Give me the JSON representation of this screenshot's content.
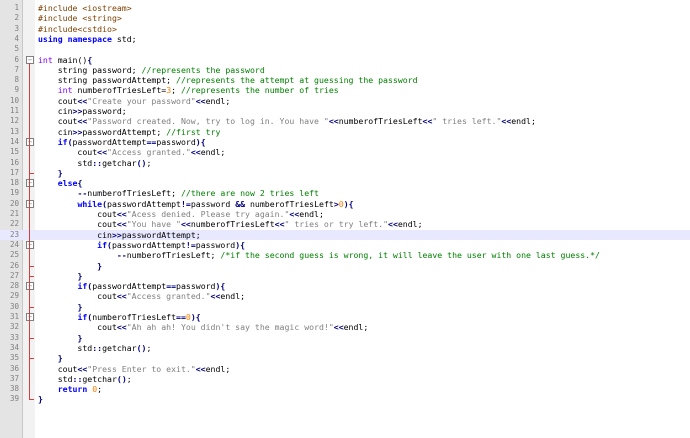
{
  "editor": {
    "lines": [
      {
        "n": "1",
        "fold": "",
        "current": false,
        "tokens": [
          {
            "t": "pp",
            "v": "#include <iostream>"
          }
        ]
      },
      {
        "n": "2",
        "fold": "",
        "current": false,
        "tokens": [
          {
            "t": "pp",
            "v": "#include <string>"
          }
        ]
      },
      {
        "n": "3",
        "fold": "",
        "current": false,
        "tokens": [
          {
            "t": "pp",
            "v": "#include<cstdio>"
          }
        ]
      },
      {
        "n": "4",
        "fold": "",
        "current": false,
        "tokens": [
          {
            "t": "kw",
            "v": "using namespace"
          },
          {
            "t": "plain",
            "v": " std;"
          }
        ]
      },
      {
        "n": "5",
        "fold": "",
        "current": false,
        "tokens": []
      },
      {
        "n": "6",
        "fold": "minus",
        "current": false,
        "tokens": [
          {
            "t": "type",
            "v": "int"
          },
          {
            "t": "plain",
            "v": " main()"
          },
          {
            "t": "op",
            "v": "{"
          }
        ]
      },
      {
        "n": "7",
        "fold": "",
        "current": false,
        "tokens": [
          {
            "t": "plain",
            "v": "    string password; "
          },
          {
            "t": "cmt",
            "v": "//represents the password"
          }
        ]
      },
      {
        "n": "8",
        "fold": "",
        "current": false,
        "tokens": [
          {
            "t": "plain",
            "v": "    string passwordAttempt; "
          },
          {
            "t": "cmt",
            "v": "//represents the attempt at guessing the password"
          }
        ]
      },
      {
        "n": "9",
        "fold": "",
        "current": false,
        "tokens": [
          {
            "t": "plain",
            "v": "    "
          },
          {
            "t": "type",
            "v": "int"
          },
          {
            "t": "plain",
            "v": " numberofTriesLeft="
          },
          {
            "t": "num",
            "v": "3"
          },
          {
            "t": "plain",
            "v": "; "
          },
          {
            "t": "cmt",
            "v": "//represents the number of tries"
          }
        ]
      },
      {
        "n": "10",
        "fold": "",
        "current": false,
        "tokens": [
          {
            "t": "plain",
            "v": "    cout"
          },
          {
            "t": "op",
            "v": "<<"
          },
          {
            "t": "str",
            "v": "\"Create your password\""
          },
          {
            "t": "op",
            "v": "<<"
          },
          {
            "t": "plain",
            "v": "endl;"
          }
        ]
      },
      {
        "n": "11",
        "fold": "",
        "current": false,
        "tokens": [
          {
            "t": "plain",
            "v": "    cin"
          },
          {
            "t": "op",
            "v": ">>"
          },
          {
            "t": "plain",
            "v": "password;"
          }
        ]
      },
      {
        "n": "12",
        "fold": "",
        "current": false,
        "tokens": [
          {
            "t": "plain",
            "v": "    cout"
          },
          {
            "t": "op",
            "v": "<<"
          },
          {
            "t": "str",
            "v": "\"Password created. Now, try to log in. You have \""
          },
          {
            "t": "op",
            "v": "<<"
          },
          {
            "t": "plain",
            "v": "numberofTriesLeft"
          },
          {
            "t": "op",
            "v": "<<"
          },
          {
            "t": "str",
            "v": "\" tries left.\""
          },
          {
            "t": "op",
            "v": "<<"
          },
          {
            "t": "plain",
            "v": "endl;"
          }
        ]
      },
      {
        "n": "13",
        "fold": "",
        "current": false,
        "tokens": [
          {
            "t": "plain",
            "v": "    cin"
          },
          {
            "t": "op",
            "v": ">>"
          },
          {
            "t": "plain",
            "v": "passwordAttempt; "
          },
          {
            "t": "cmt",
            "v": "//first try"
          }
        ]
      },
      {
        "n": "14",
        "fold": "minus",
        "current": false,
        "tokens": [
          {
            "t": "plain",
            "v": "    "
          },
          {
            "t": "kw",
            "v": "if"
          },
          {
            "t": "op",
            "v": "("
          },
          {
            "t": "plain",
            "v": "passwordAttempt"
          },
          {
            "t": "op",
            "v": "=="
          },
          {
            "t": "plain",
            "v": "password"
          },
          {
            "t": "op",
            "v": "){"
          }
        ]
      },
      {
        "n": "15",
        "fold": "",
        "current": false,
        "tokens": [
          {
            "t": "plain",
            "v": "        cout"
          },
          {
            "t": "op",
            "v": "<<"
          },
          {
            "t": "str",
            "v": "\"Access granted.\""
          },
          {
            "t": "op",
            "v": "<<"
          },
          {
            "t": "plain",
            "v": "endl;"
          }
        ]
      },
      {
        "n": "16",
        "fold": "",
        "current": false,
        "tokens": [
          {
            "t": "plain",
            "v": "        std"
          },
          {
            "t": "op",
            "v": "::"
          },
          {
            "t": "plain",
            "v": "getchar"
          },
          {
            "t": "op",
            "v": "()"
          },
          {
            "t": "plain",
            "v": ";"
          }
        ]
      },
      {
        "n": "17",
        "fold": "end",
        "current": false,
        "tokens": [
          {
            "t": "plain",
            "v": "    "
          },
          {
            "t": "op",
            "v": "}"
          }
        ]
      },
      {
        "n": "18",
        "fold": "minus",
        "current": false,
        "tokens": [
          {
            "t": "plain",
            "v": "    "
          },
          {
            "t": "kw",
            "v": "else"
          },
          {
            "t": "op",
            "v": "{"
          }
        ]
      },
      {
        "n": "19",
        "fold": "",
        "current": false,
        "tokens": [
          {
            "t": "plain",
            "v": "        "
          },
          {
            "t": "op",
            "v": "--"
          },
          {
            "t": "plain",
            "v": "numberofTriesLeft; "
          },
          {
            "t": "cmt",
            "v": "//there are now 2 tries left"
          }
        ]
      },
      {
        "n": "20",
        "fold": "minus",
        "current": false,
        "tokens": [
          {
            "t": "plain",
            "v": "        "
          },
          {
            "t": "kw",
            "v": "while"
          },
          {
            "t": "op",
            "v": "("
          },
          {
            "t": "plain",
            "v": "passwordAttempt"
          },
          {
            "t": "op",
            "v": "!="
          },
          {
            "t": "plain",
            "v": "password "
          },
          {
            "t": "op",
            "v": "&&"
          },
          {
            "t": "plain",
            "v": " numberofTriesLeft"
          },
          {
            "t": "op",
            "v": ">"
          },
          {
            "t": "num",
            "v": "0"
          },
          {
            "t": "op",
            "v": "){"
          }
        ]
      },
      {
        "n": "21",
        "fold": "",
        "current": false,
        "tokens": [
          {
            "t": "plain",
            "v": "            cout"
          },
          {
            "t": "op",
            "v": "<<"
          },
          {
            "t": "str",
            "v": "\"Acess denied. Please try again.\""
          },
          {
            "t": "op",
            "v": "<<"
          },
          {
            "t": "plain",
            "v": "endl;"
          }
        ]
      },
      {
        "n": "22",
        "fold": "",
        "current": false,
        "tokens": [
          {
            "t": "plain",
            "v": "            cout"
          },
          {
            "t": "op",
            "v": "<<"
          },
          {
            "t": "str",
            "v": "\"You have \""
          },
          {
            "t": "op",
            "v": "<<"
          },
          {
            "t": "plain",
            "v": "numberofTriesLeft"
          },
          {
            "t": "op",
            "v": "<<"
          },
          {
            "t": "str",
            "v": "\" tries or try left.\""
          },
          {
            "t": "op",
            "v": "<<"
          },
          {
            "t": "plain",
            "v": "endl;"
          }
        ]
      },
      {
        "n": "23",
        "fold": "",
        "current": true,
        "tokens": [
          {
            "t": "plain",
            "v": "            cin"
          },
          {
            "t": "op",
            "v": ">>"
          },
          {
            "t": "plain",
            "v": "passwordAttempt;"
          }
        ]
      },
      {
        "n": "24",
        "fold": "minus",
        "current": false,
        "tokens": [
          {
            "t": "plain",
            "v": "            "
          },
          {
            "t": "kw",
            "v": "if"
          },
          {
            "t": "op",
            "v": "("
          },
          {
            "t": "plain",
            "v": "passwordAttempt"
          },
          {
            "t": "op",
            "v": "!="
          },
          {
            "t": "plain",
            "v": "password"
          },
          {
            "t": "op",
            "v": "){"
          }
        ]
      },
      {
        "n": "25",
        "fold": "",
        "current": false,
        "tokens": [
          {
            "t": "plain",
            "v": "                "
          },
          {
            "t": "op",
            "v": "--"
          },
          {
            "t": "plain",
            "v": "numberofTriesLeft; "
          },
          {
            "t": "cmt",
            "v": "/*if the second guess is wrong, it will leave the user with one last guess.*/"
          }
        ]
      },
      {
        "n": "26",
        "fold": "end",
        "current": false,
        "tokens": [
          {
            "t": "plain",
            "v": "            "
          },
          {
            "t": "op",
            "v": "}"
          }
        ]
      },
      {
        "n": "27",
        "fold": "end",
        "current": false,
        "tokens": [
          {
            "t": "plain",
            "v": "        "
          },
          {
            "t": "op",
            "v": "}"
          }
        ]
      },
      {
        "n": "28",
        "fold": "minus",
        "current": false,
        "tokens": [
          {
            "t": "plain",
            "v": "        "
          },
          {
            "t": "kw",
            "v": "if"
          },
          {
            "t": "op",
            "v": "("
          },
          {
            "t": "plain",
            "v": "passwordAttempt"
          },
          {
            "t": "op",
            "v": "=="
          },
          {
            "t": "plain",
            "v": "password"
          },
          {
            "t": "op",
            "v": "){"
          }
        ]
      },
      {
        "n": "29",
        "fold": "",
        "current": false,
        "tokens": [
          {
            "t": "plain",
            "v": "            cout"
          },
          {
            "t": "op",
            "v": "<<"
          },
          {
            "t": "str",
            "v": "\"Access granted.\""
          },
          {
            "t": "op",
            "v": "<<"
          },
          {
            "t": "plain",
            "v": "endl;"
          }
        ]
      },
      {
        "n": "30",
        "fold": "end",
        "current": false,
        "tokens": [
          {
            "t": "plain",
            "v": "        "
          },
          {
            "t": "op",
            "v": "}"
          }
        ]
      },
      {
        "n": "31",
        "fold": "minus",
        "current": false,
        "tokens": [
          {
            "t": "plain",
            "v": "        "
          },
          {
            "t": "kw",
            "v": "if"
          },
          {
            "t": "op",
            "v": "("
          },
          {
            "t": "plain",
            "v": "numberofTriesLeft"
          },
          {
            "t": "op",
            "v": "=="
          },
          {
            "t": "num",
            "v": "0"
          },
          {
            "t": "op",
            "v": "){"
          }
        ]
      },
      {
        "n": "32",
        "fold": "",
        "current": false,
        "tokens": [
          {
            "t": "plain",
            "v": "            cout"
          },
          {
            "t": "op",
            "v": "<<"
          },
          {
            "t": "str",
            "v": "\"Ah ah ah! You didn't say the magic word!\""
          },
          {
            "t": "op",
            "v": "<<"
          },
          {
            "t": "plain",
            "v": "endl;"
          }
        ]
      },
      {
        "n": "33",
        "fold": "end",
        "current": false,
        "tokens": [
          {
            "t": "plain",
            "v": "        "
          },
          {
            "t": "op",
            "v": "}"
          }
        ]
      },
      {
        "n": "34",
        "fold": "",
        "current": false,
        "tokens": [
          {
            "t": "plain",
            "v": "        std"
          },
          {
            "t": "op",
            "v": "::"
          },
          {
            "t": "plain",
            "v": "getchar"
          },
          {
            "t": "op",
            "v": "()"
          },
          {
            "t": "plain",
            "v": ";"
          }
        ]
      },
      {
        "n": "35",
        "fold": "end",
        "current": false,
        "tokens": [
          {
            "t": "plain",
            "v": "    "
          },
          {
            "t": "op",
            "v": "}"
          }
        ]
      },
      {
        "n": "36",
        "fold": "",
        "current": false,
        "tokens": [
          {
            "t": "plain",
            "v": "    cout"
          },
          {
            "t": "op",
            "v": "<<"
          },
          {
            "t": "str",
            "v": "\"Press Enter to exit.\""
          },
          {
            "t": "op",
            "v": "<<"
          },
          {
            "t": "plain",
            "v": "endl;"
          }
        ]
      },
      {
        "n": "37",
        "fold": "",
        "current": false,
        "tokens": [
          {
            "t": "plain",
            "v": "    std"
          },
          {
            "t": "op",
            "v": "::"
          },
          {
            "t": "plain",
            "v": "getchar"
          },
          {
            "t": "op",
            "v": "()"
          },
          {
            "t": "plain",
            "v": ";"
          }
        ]
      },
      {
        "n": "38",
        "fold": "",
        "current": false,
        "tokens": [
          {
            "t": "plain",
            "v": "    "
          },
          {
            "t": "kw",
            "v": "return"
          },
          {
            "t": "plain",
            "v": " "
          },
          {
            "t": "num",
            "v": "0"
          },
          {
            "t": "plain",
            "v": ";"
          }
        ]
      },
      {
        "n": "39",
        "fold": "end",
        "current": false,
        "tokens": [
          {
            "t": "op",
            "v": "}"
          }
        ]
      }
    ]
  },
  "colors": {
    "gutter": "#e4e4e4",
    "current_line": "#e8e8ff",
    "preprocessor": "#804000",
    "keyword": "#0000ff",
    "type": "#8000ff",
    "string": "#808080",
    "comment": "#008000",
    "number": "#ff8000",
    "operator": "#000080",
    "fold_marker": "#d04040"
  }
}
